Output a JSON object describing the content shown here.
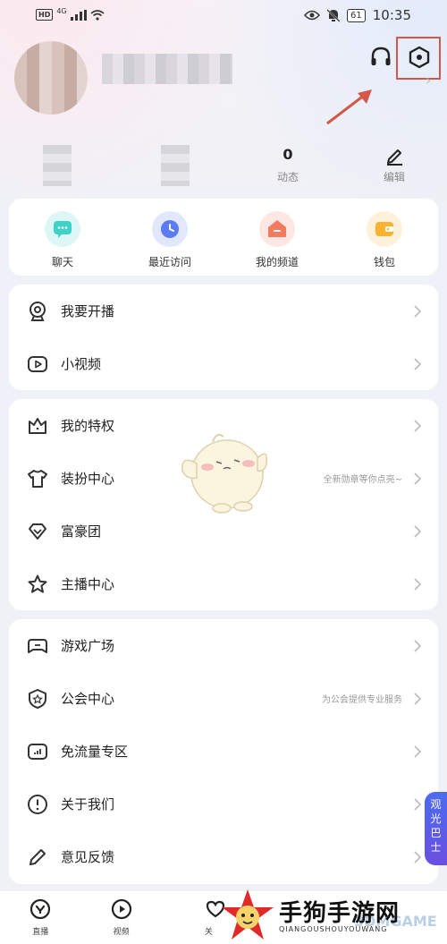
{
  "status_bar": {
    "network": "HD",
    "signal_label": "4G",
    "battery": "61",
    "time": "10:35"
  },
  "profile": {
    "stats": [
      {
        "value": "0",
        "label": "动态"
      },
      {
        "value": "",
        "label": "编辑"
      }
    ]
  },
  "quick_actions": [
    {
      "label": "聊天",
      "icon": "chat-icon",
      "color": "#3fd3c8"
    },
    {
      "label": "最近访问",
      "icon": "clock-icon",
      "color": "#5b7cf5"
    },
    {
      "label": "我的频道",
      "icon": "channel-icon",
      "color": "#f27a5e"
    },
    {
      "label": "钱包",
      "icon": "wallet-icon",
      "color": "#f7b331"
    }
  ],
  "menu_group_1": [
    {
      "label": "我要开播",
      "icon": "broadcast-icon",
      "sub": ""
    },
    {
      "label": "小视频",
      "icon": "video-icon",
      "sub": ""
    }
  ],
  "menu_group_2": [
    {
      "label": "我的特权",
      "icon": "crown-icon",
      "sub": ""
    },
    {
      "label": "装扮中心",
      "icon": "shirt-icon",
      "sub": "全新勋章等你点亮~"
    },
    {
      "label": "富豪团",
      "icon": "diamond-icon",
      "sub": ""
    },
    {
      "label": "主播中心",
      "icon": "star-icon",
      "sub": ""
    }
  ],
  "menu_group_3": [
    {
      "label": "游戏广场",
      "icon": "gamepad-icon",
      "sub": ""
    },
    {
      "label": "公会中心",
      "icon": "guild-shield-icon",
      "sub": "为公会提供专业服务"
    },
    {
      "label": "免流量专区",
      "icon": "data-free-icon",
      "sub": ""
    },
    {
      "label": "关于我们",
      "icon": "info-icon",
      "sub": ""
    },
    {
      "label": "意见反馈",
      "icon": "pencil-icon",
      "sub": ""
    }
  ],
  "bottom_nav": [
    {
      "label": "直播",
      "icon": "live-icon"
    },
    {
      "label": "视频",
      "icon": "play-icon"
    },
    {
      "label": "关",
      "icon": "follow-icon"
    }
  ],
  "floating_badge": "观光巴士",
  "watermark": {
    "title": "手狗手游网",
    "subtitle": "QIANGOUSHOUYOUWANG",
    "overlay": "3DMGAME"
  },
  "colors": {
    "annotation": "#d4574a",
    "card_bg": "#ffffff"
  }
}
